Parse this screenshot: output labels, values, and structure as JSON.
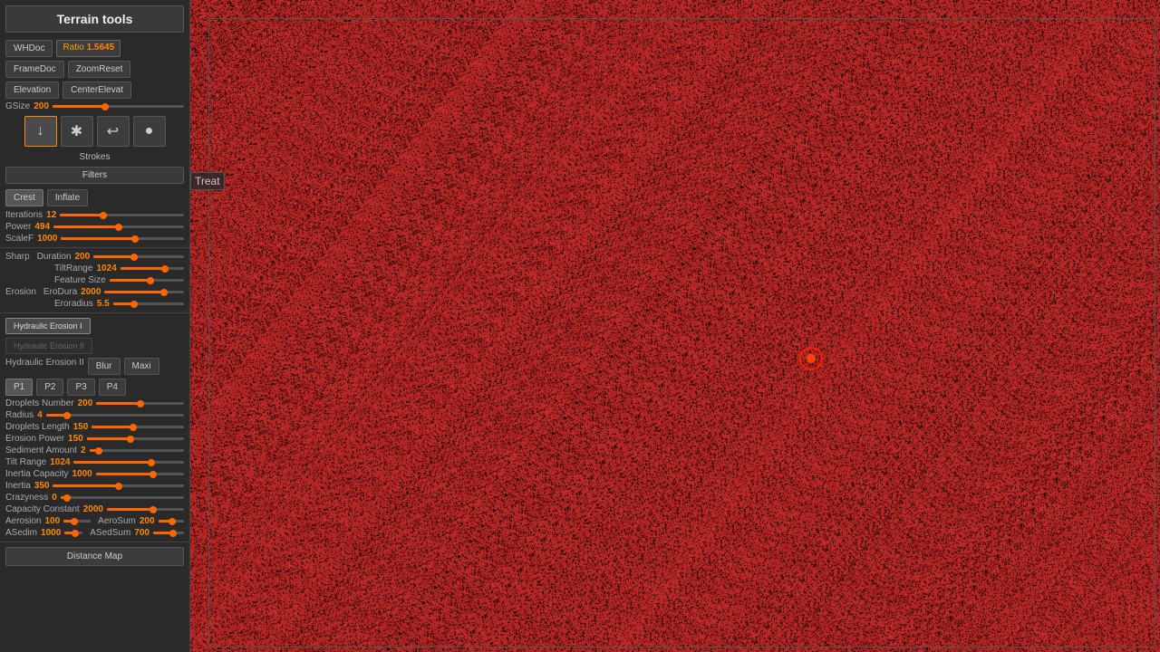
{
  "app": {
    "title": "Terrain tools",
    "coords": "0.242,0.183,0.249"
  },
  "sidebar": {
    "title": "Terrain tools",
    "buttons": {
      "wh_doc": "WHDoc",
      "frame_doc": "FrameDoc",
      "elevation": "Elevation",
      "ratio_label": "Ratio",
      "ratio_value": "1.5645",
      "zoom_reset": "ZoomReset",
      "center_elevat": "CenterElevat",
      "gsize_label": "GSize",
      "gsize_value": "200"
    },
    "strokes": {
      "label": "Strokes",
      "tools": [
        "↓",
        "✱",
        "↩",
        "●"
      ]
    },
    "filters": {
      "label": "Filters",
      "crest": "Crest",
      "inflate": "Inflate"
    },
    "params": {
      "iterations_label": "Iterations",
      "iterations_value": "12",
      "power_label": "Power",
      "power_value": "494",
      "scalef_label": "ScaleF",
      "scalef_value": "1000",
      "duration_label": "Duration",
      "duration_value": "200",
      "tilt_range_label": "TiltRange",
      "tilt_range_value": "1024",
      "feature_size_label": "Feature Size",
      "sharp_label": "Sharp",
      "erodura_label": "EroDura",
      "erodura_value": "2000",
      "erosion_label": "Erosion",
      "eroradius_label": "Eroradius",
      "eroradius_value": "5.5"
    },
    "hydraulic": {
      "h1_active": "Hydraulic Erosion I",
      "h2_inactive": "Hydraulic Erosion II",
      "h2_label": "Hydraulic Erosion II",
      "blur": "Blur",
      "maxi": "Maxi",
      "p_buttons": [
        "P1",
        "P2",
        "P3",
        "P4"
      ],
      "droplets_number_label": "Droplets Number",
      "droplets_number_value": "200",
      "radius_label": "Radius",
      "radius_value": "4",
      "droplets_length_label": "Droplets Length",
      "droplets_length_value": "150",
      "erosion_power_label": "Erosion Power",
      "erosion_power_value": "150",
      "sediment_amount_label": "Sediment Amount",
      "sediment_amount_value": "2",
      "tilt_range_label": "Tilt Range",
      "tilt_range_value": "1024",
      "inertia_capacity_label": "Inertia Capacity",
      "inertia_capacity_value": "1000",
      "inertia_label": "Inertia",
      "inertia_value": "350",
      "crazyness_label": "Crazyness",
      "crazyness_value": "0",
      "capacity_constant_label": "Capacity Constant",
      "capacity_constant_value": "2000",
      "aerosion_label": "Aerosion",
      "aerosion_value": "100",
      "aerosum_label": "AeroSum",
      "aerosum_value": "200",
      "asedim_label": "ASedim",
      "asedim_value": "1000",
      "asedsum_label": "ASedSum",
      "asedsum_value": "700"
    },
    "distance_map": "Distance Map",
    "treat": "Treat"
  }
}
